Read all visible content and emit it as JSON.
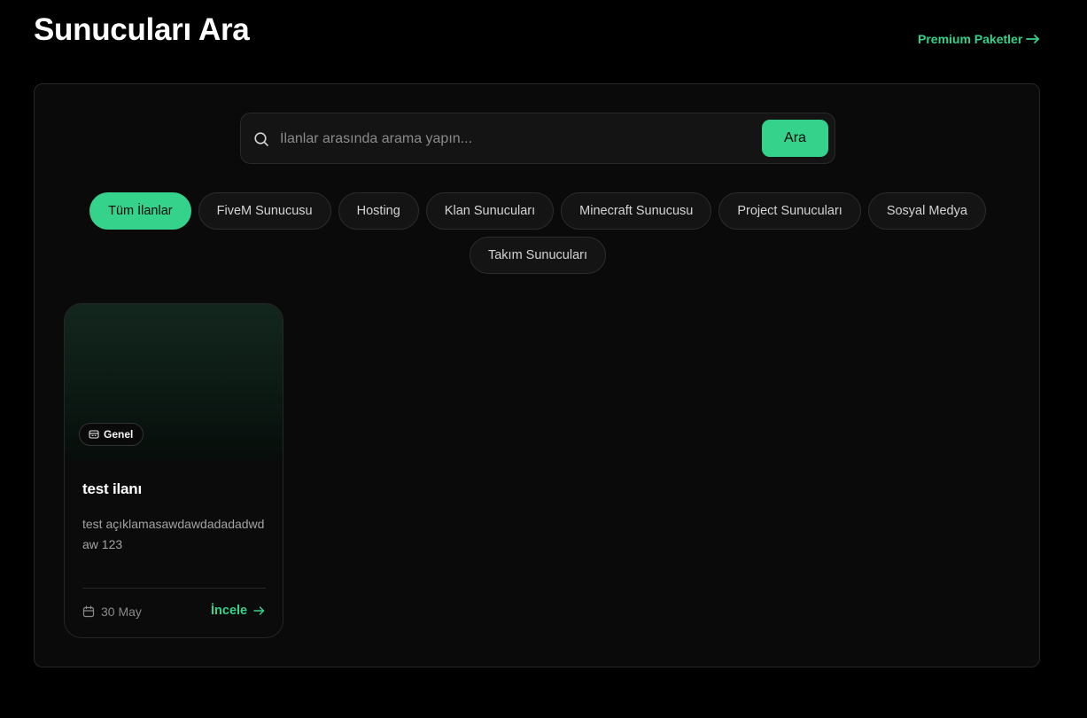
{
  "header": {
    "title": "Sunucuları Ara",
    "premium_link": "Premium Paketler"
  },
  "search": {
    "placeholder": "İlanlar arasında arama yapın...",
    "value": "",
    "button_label": "Ara"
  },
  "categories": [
    {
      "label": "Tüm İlanlar",
      "active": true
    },
    {
      "label": "FiveM Sunucusu",
      "active": false
    },
    {
      "label": "Hosting",
      "active": false
    },
    {
      "label": "Klan Sunucuları",
      "active": false
    },
    {
      "label": "Minecraft Sunucusu",
      "active": false
    },
    {
      "label": "Project Sunucuları",
      "active": false
    },
    {
      "label": "Sosyal Medya",
      "active": false
    },
    {
      "label": "Takım Sunucuları",
      "active": false
    }
  ],
  "listings": [
    {
      "category": "Genel",
      "title": "test ilanı",
      "description": "test açıklamasawdawdadadadwdaw 123",
      "date": "30 May",
      "action_label": "İncele"
    }
  ],
  "colors": {
    "accent": "#34d28a",
    "background": "#000000",
    "panel": "#0a0a0a",
    "border": "#262626"
  },
  "icons": {
    "search": "search-icon",
    "premium_arrow": "arrow-right-icon",
    "badge": "tag-icon",
    "date": "calendar-icon",
    "action_arrow": "arrow-right-icon"
  }
}
